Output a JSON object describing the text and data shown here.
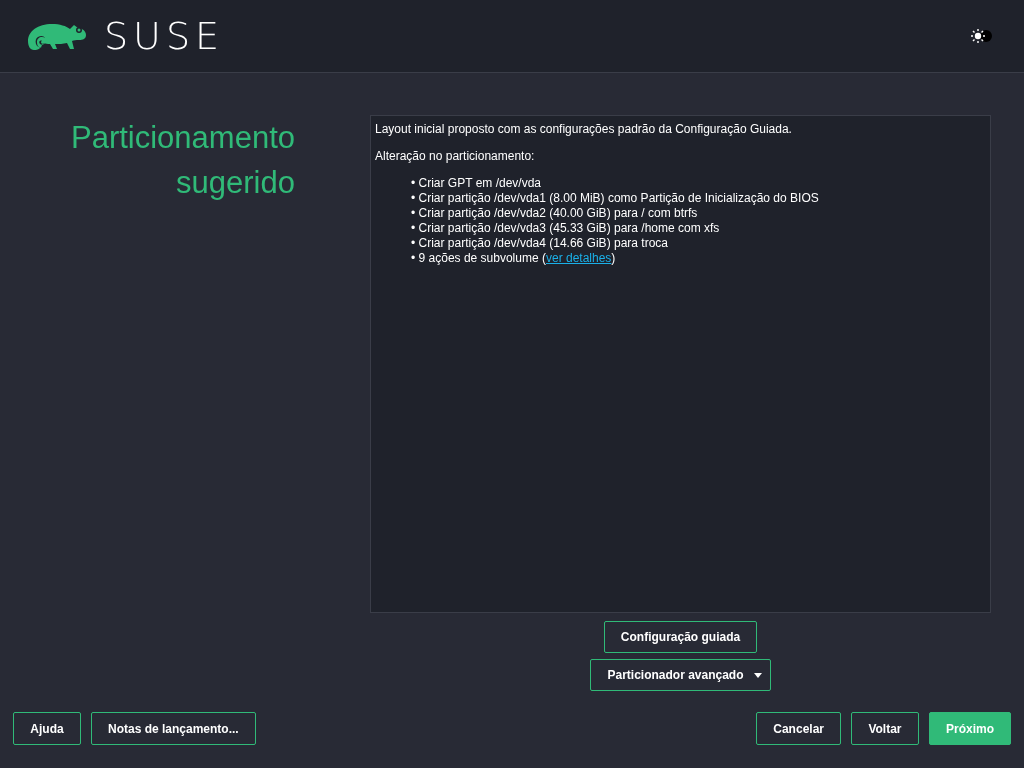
{
  "header": {
    "logo_text": "SUSE"
  },
  "page": {
    "title": "Particionamento sugerido"
  },
  "proposal": {
    "intro": "Layout inicial proposto com as configurações padrão da Configuração Guiada.",
    "heading": "Alteração no particionamento:",
    "items": [
      {
        "text": "• Criar GPT em /dev/vda"
      },
      {
        "text": "• Criar partição /dev/vda1 (8.00 MiB) como Partição de Inicialização do BIOS"
      },
      {
        "text": "• Criar partição /dev/vda2 (40.00 GiB) para / com btrfs"
      },
      {
        "text": "• Criar partição /dev/vda3 (45.33 GiB) para /home com xfs"
      },
      {
        "text": "• Criar partição /dev/vda4 (14.66 GiB) para troca"
      },
      {
        "text": "• 9 ações de subvolume (",
        "link": "ver detalhes",
        "after": ")"
      }
    ]
  },
  "actions": [
    {
      "label": "Configuração guiada",
      "kind": "button"
    },
    {
      "label": "Particionador avançado",
      "kind": "menu"
    }
  ],
  "footer_left": [
    {
      "label": "Ajuda",
      "primary": false
    },
    {
      "label": "Notas de lançamento...",
      "primary": false
    }
  ],
  "footer_right": [
    {
      "label": "Cancelar",
      "primary": false
    },
    {
      "label": "Voltar",
      "primary": false
    },
    {
      "label": "Próximo",
      "primary": true
    }
  ]
}
